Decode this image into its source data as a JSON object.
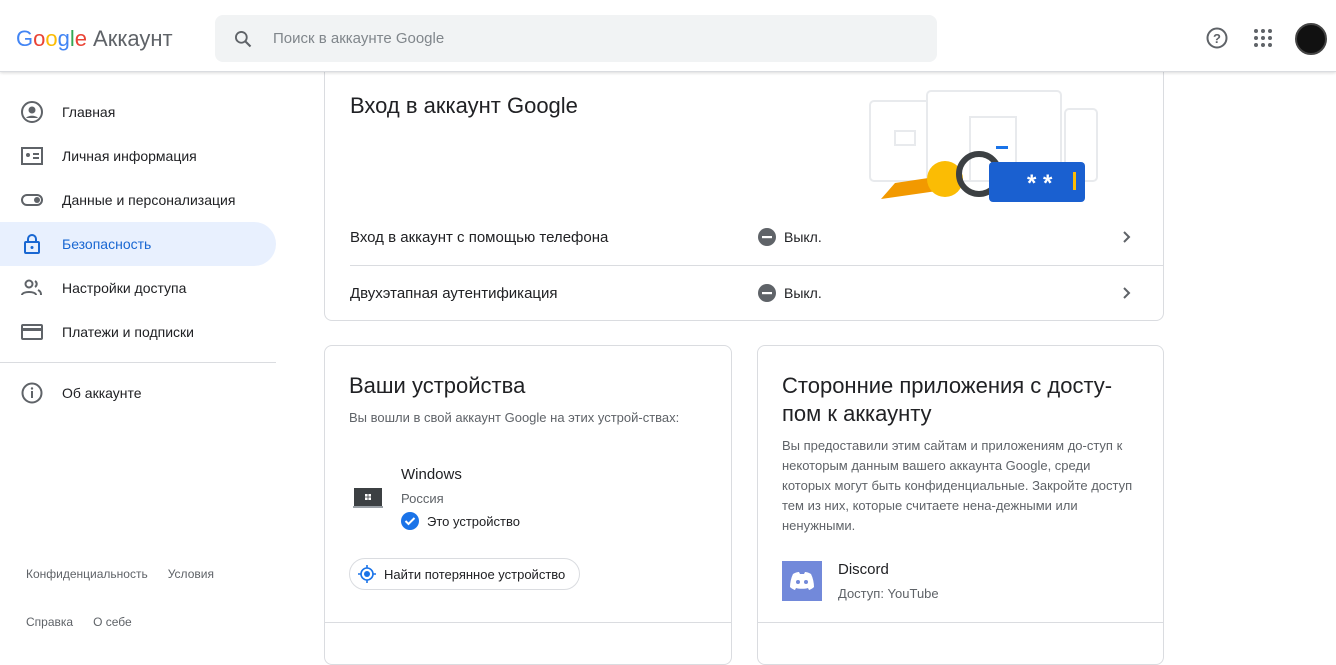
{
  "header": {
    "logo_google": "Google",
    "logo_account": "Аккаунт",
    "search_placeholder": "Поиск в аккаунте Google"
  },
  "sidebar": {
    "items": [
      {
        "label": "Главная"
      },
      {
        "label": "Личная информация"
      },
      {
        "label": "Данные и персонализация"
      },
      {
        "label": "Безопасность"
      },
      {
        "label": "Настройки доступа"
      },
      {
        "label": "Платежи и подписки"
      },
      {
        "label": "Об аккаунте"
      }
    ],
    "footer": [
      "Конфиденциальность",
      "Условия",
      "Справка",
      "О себе"
    ]
  },
  "signin": {
    "title": "Вход в аккаунт Google",
    "rows": [
      {
        "label": "Вход в аккаунт с помощью телефона",
        "status": "Выкл."
      },
      {
        "label": "Двухэтапная аутентификация",
        "status": "Выкл."
      }
    ]
  },
  "devices": {
    "title": "Ваши устройства",
    "desc": "Вы вошли в свой аккаунт Google на этих устрой-ствах:",
    "device": {
      "name": "Windows",
      "location": "Россия",
      "current": "Это устройство"
    },
    "find_button": "Найти потерянное устройство"
  },
  "apps": {
    "title": "Сторонние приложения с досту-пом к аккаунту",
    "desc": "Вы предоставили этим сайтам и приложениям до-ступ к некоторым данным вашего аккаунта Google, среди которых могут быть конфиденциальные. Закройте доступ тем из них, которые считаете нена-дежными или ненужными.",
    "app": {
      "name": "Discord",
      "access": "Доступ: YouTube"
    }
  },
  "colors": {
    "accent": "#1a73e8",
    "active_bg": "#e8f0fe"
  }
}
